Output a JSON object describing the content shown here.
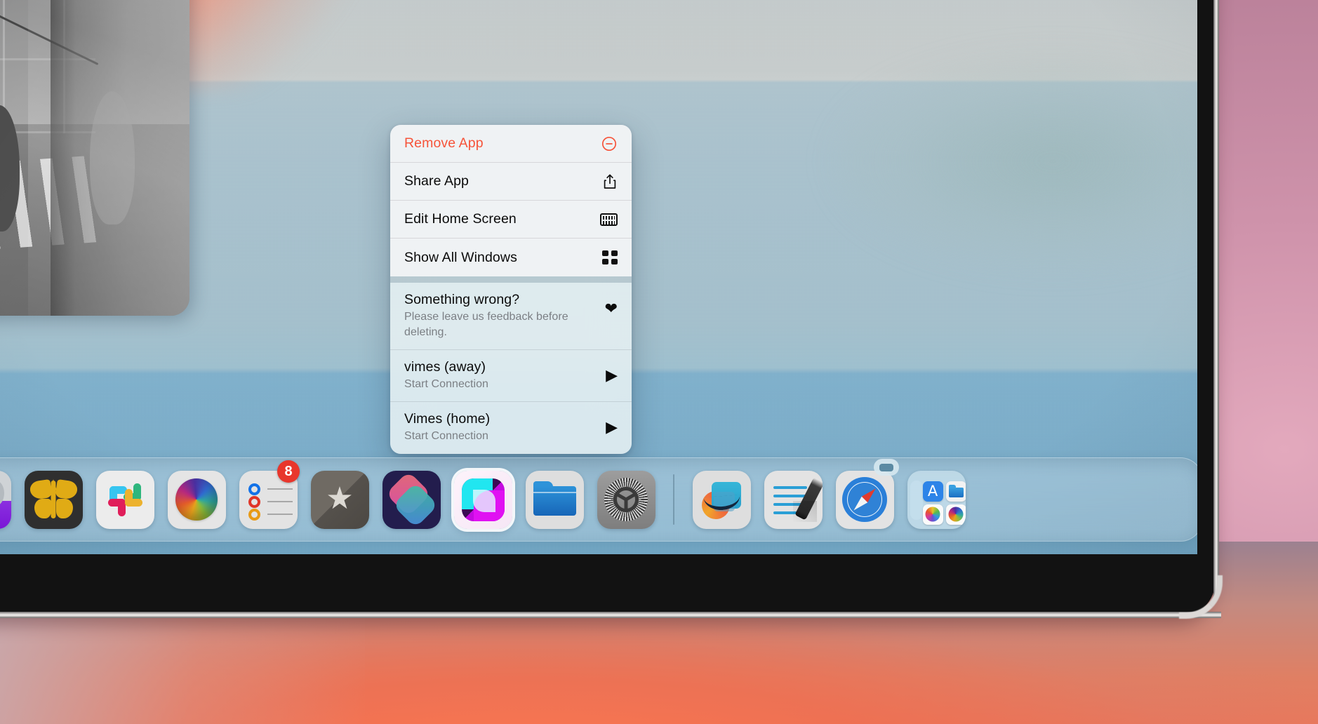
{
  "scene": {
    "device": "ipad-dock-context-menu",
    "colors": {
      "menu_destructive": "#f6543a",
      "menu_bg": "#f4f5f6",
      "menu_bg_lower": "#e6f0f3",
      "badge_red": "#e8362c",
      "wallpaper_sky": "#c3cacb",
      "wallpaper_water": "#79acc9",
      "desk_coral": "#e8785c",
      "backdrop_mauve": "#c295ac",
      "bezel_black": "#121212",
      "rim_silver": "#d8d5d3"
    }
  },
  "photo_window": {
    "name": "Photo window",
    "description": "Black and white street photograph of a city crosswalk with bare tree and pedestrians"
  },
  "context_menu": {
    "groups": [
      {
        "id": "app-actions",
        "items": [
          {
            "title": "Remove App",
            "subtitle": "",
            "icon": "minus-circle-icon",
            "destructive": true,
            "kind": "single"
          },
          {
            "title": "Share App",
            "subtitle": "",
            "icon": "share-icon",
            "destructive": false,
            "kind": "single"
          },
          {
            "title": "Edit Home Screen",
            "subtitle": "",
            "icon": "keyboard-icon",
            "destructive": false,
            "kind": "single"
          },
          {
            "title": "Show All Windows",
            "subtitle": "",
            "icon": "grid-icon",
            "destructive": false,
            "kind": "single"
          }
        ]
      },
      {
        "id": "app-shortcuts",
        "items": [
          {
            "title": "Something wrong?",
            "subtitle": "Please leave us feedback before deleting.",
            "icon": "heart-icon",
            "destructive": false,
            "kind": "feedback"
          },
          {
            "title": "vimes (away)",
            "subtitle": "Start Connection",
            "icon": "play-icon",
            "destructive": false,
            "kind": "two-line"
          },
          {
            "title": "Vimes (home)",
            "subtitle": "Start Connection",
            "icon": "play-icon",
            "destructive": false,
            "kind": "two-line"
          }
        ]
      }
    ]
  },
  "dock": {
    "items": [
      {
        "name": "elephant-app",
        "label": "Elephant",
        "art": "ic-elephant",
        "badge": "",
        "indicator": false,
        "selected": false,
        "separator_after": false
      },
      {
        "name": "butterfly-app",
        "label": "Ulysses",
        "art": "ic-butterfly",
        "badge": "",
        "indicator": false,
        "selected": false,
        "separator_after": false
      },
      {
        "name": "slack-app",
        "label": "Slack",
        "art": "ic-slack",
        "badge": "",
        "indicator": false,
        "selected": false,
        "separator_after": false
      },
      {
        "name": "colorwheel-app",
        "label": "Color Wheel",
        "art": "ic-colorwheel",
        "badge": "",
        "indicator": false,
        "selected": false,
        "separator_after": false
      },
      {
        "name": "reminders-app",
        "label": "Reminders",
        "art": "ic-reminders",
        "badge": "8",
        "indicator": false,
        "selected": false,
        "separator_after": false
      },
      {
        "name": "star-app",
        "label": "Favorites",
        "art": "ic-star",
        "badge": "",
        "indicator": false,
        "selected": false,
        "separator_after": false
      },
      {
        "name": "shortcuts-app",
        "label": "Shortcuts",
        "art": "ic-shortcuts",
        "badge": "",
        "indicator": false,
        "selected": false,
        "separator_after": false
      },
      {
        "name": "screens-app",
        "label": "Screens",
        "art": "ic-screens",
        "badge": "",
        "indicator": false,
        "selected": true,
        "separator_after": false
      },
      {
        "name": "files-app",
        "label": "Files",
        "art": "ic-folder",
        "badge": "",
        "indicator": false,
        "selected": false,
        "separator_after": false
      },
      {
        "name": "settings-app",
        "label": "Settings",
        "art": "ic-settings",
        "badge": "",
        "indicator": false,
        "selected": false,
        "separator_after": true
      },
      {
        "name": "freeform-app",
        "label": "Freeform",
        "art": "ic-freeform",
        "badge": "",
        "indicator": false,
        "selected": false,
        "separator_after": false
      },
      {
        "name": "notes-app",
        "label": "Notes",
        "art": "ic-notes2",
        "badge": "",
        "indicator": false,
        "selected": false,
        "separator_after": false
      },
      {
        "name": "safari-app",
        "label": "Safari",
        "art": "ic-safari",
        "badge": "",
        "indicator": true,
        "selected": false,
        "separator_after": false
      },
      {
        "name": "folder-stack",
        "label": "App Folder",
        "art": "ic-folderstack",
        "badge": "",
        "indicator": false,
        "selected": false,
        "separator_after": false
      }
    ]
  }
}
